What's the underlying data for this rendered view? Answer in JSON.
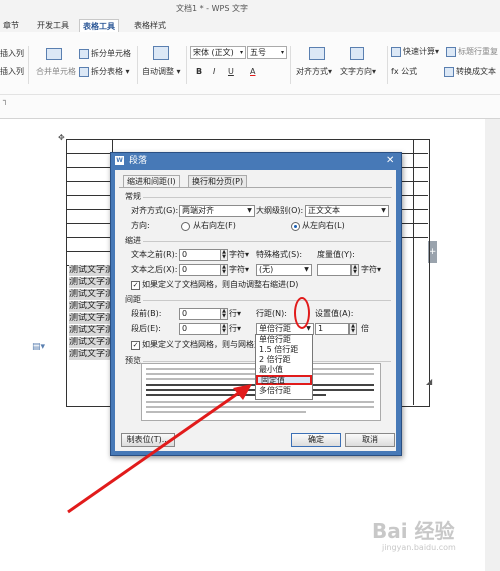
{
  "window": {
    "title": "文档1 * - WPS 文字"
  },
  "ribbon": {
    "tabs": [
      "章节",
      "开发工具",
      "表格工具",
      "表格样式"
    ],
    "active_tab": "表格工具",
    "items": {
      "insert_col_1": "插入列",
      "insert_col_2": "插入列",
      "merge_cells": "合并单元格",
      "split_cells": "拆分单元格",
      "split_table": "拆分表格",
      "auto_adjust": "自动调整",
      "font": "宋体 (正文)",
      "size": "五号",
      "bold": "B",
      "italic": "I",
      "underline": "U",
      "font_color": "A",
      "align": "对齐方式",
      "text_dir": "文字方向",
      "quick_calc": "快速计算",
      "title_row_repeat": "标题行重复",
      "formula": "fx 公式",
      "to_text": "转换成文本"
    }
  },
  "document": {
    "cell_text": [
      "测试文字测",
      "测试文字测",
      "测试文字测",
      "测试文字测",
      "测试文字测",
      "测试文字测",
      "测试文字测",
      "测试文字测"
    ]
  },
  "dialog": {
    "title": "段落",
    "tabs": [
      "缩进和间距(I)",
      "换行和分页(P)"
    ],
    "general": {
      "section": "常规",
      "align_label": "对齐方式(G):",
      "align_value": "两端对齐",
      "outline_label": "大纲级别(O):",
      "outline_value": "正文文本",
      "direction_label": "方向:",
      "rtl": "从右向左(F)",
      "ltr": "从左向右(L)"
    },
    "indent": {
      "section": "缩进",
      "before_label": "文本之前(R):",
      "before_value": "0",
      "before_unit": "字符",
      "after_label": "文本之后(X):",
      "after_value": "0",
      "after_unit": "字符",
      "special_label": "特殊格式(S):",
      "special_value": "(无)",
      "measure_label": "度量值(Y):",
      "measure_unit": "字符",
      "grid_check": "如果定义了文档网格，则自动调整右缩进(D)"
    },
    "spacing": {
      "section": "间距",
      "before_label": "段前(B):",
      "before_value": "0",
      "before_unit": "行",
      "after_label": "段后(E):",
      "after_value": "0",
      "after_unit": "行",
      "line_label": "行距(N):",
      "line_value": "单倍行距",
      "setting_label": "设置值(A):",
      "setting_value": "1",
      "setting_unit": "倍",
      "grid_check": "如果定义了文档网格，则与网格对"
    },
    "preview_label": "预览",
    "tab_stops_button": "制表位(T)...",
    "ok_button": "确定",
    "cancel_button": "取消",
    "line_spacing_options": [
      "单倍行距",
      "1.5 倍行距",
      "2 倍行距",
      "最小值",
      "固定值",
      "多倍行距"
    ],
    "selected_option": "固定值"
  },
  "watermark": {
    "text": "Bai 经验",
    "sub": "jingyan.baidu.com"
  },
  "colors": {
    "annotation_red": "#e11b1b",
    "dialog_blue": "#4779b7",
    "ribbon_accent": "#2b5797"
  }
}
